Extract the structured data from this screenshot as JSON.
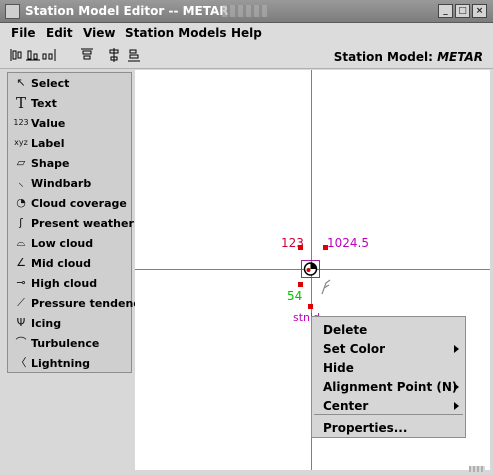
{
  "window": {
    "title": "Station Model Editor -- METAR",
    "buttons": {
      "minimize": "_",
      "maximize": "□",
      "close": "×"
    }
  },
  "menu": [
    "File",
    "Edit",
    "View",
    "Station Models",
    "Help"
  ],
  "toolbar": {
    "icons": [
      "align-left-icon",
      "align-center-icon",
      "align-right-icon",
      "align-top-icon",
      "align-middle-icon",
      "align-bottom-icon"
    ],
    "station_label": "Station Model:",
    "station_name": "METAR"
  },
  "palette": [
    {
      "label": "Select",
      "icon": "↖"
    },
    {
      "label": "Text",
      "icon": "T"
    },
    {
      "label": "Value",
      "icon": "123"
    },
    {
      "label": "Label",
      "icon": "xyz"
    },
    {
      "label": "Shape",
      "icon": "▱"
    },
    {
      "label": "Windbarb",
      "icon": "⸜"
    },
    {
      "label": "Cloud coverage",
      "icon": "◔"
    },
    {
      "label": "Present weather",
      "icon": "ʃ"
    },
    {
      "label": "Low cloud",
      "icon": "⌓"
    },
    {
      "label": "Mid cloud",
      "icon": "∠"
    },
    {
      "label": "High cloud",
      "icon": "⊸"
    },
    {
      "label": "Pressure tendency",
      "icon": "⟋"
    },
    {
      "label": "Icing",
      "icon": "Ψ"
    },
    {
      "label": "Turbulence",
      "icon": "⌒"
    },
    {
      "label": "Lightning",
      "icon": "〈"
    }
  ],
  "canvas": {
    "temp_label": "123",
    "pressure_label": "1024.5",
    "dewpoint_label": "54",
    "station_label": "stnid"
  },
  "context_menu": [
    {
      "label": "Delete",
      "submenu": false
    },
    {
      "label": "Set Color",
      "submenu": true
    },
    {
      "label": "Hide",
      "submenu": false
    },
    {
      "label": "Alignment Point (N)",
      "submenu": true
    },
    {
      "label": "Center",
      "submenu": true
    },
    {
      "label": "Properties...",
      "submenu": false
    }
  ],
  "colors": {
    "temp": "#d0003a",
    "pressure": "#c000c0",
    "dewpoint": "#00c000",
    "station": "#c000c0",
    "handle": "#e00000"
  }
}
